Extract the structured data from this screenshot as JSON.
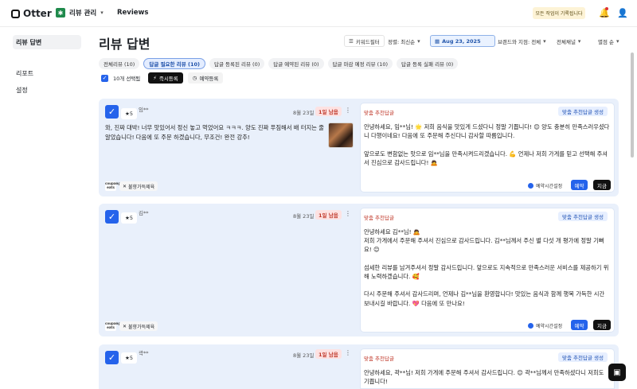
{
  "app": {
    "name": "Otter",
    "store_label": "리뷰 관리",
    "nav_reviews": "Reviews",
    "banner": "모든 작업이 기록됩니다",
    "store_icon": "store-icon"
  },
  "sidebar": {
    "items": [
      {
        "label": "리뷰 답변"
      },
      {
        "label": "리포트"
      },
      {
        "label": "설정"
      }
    ]
  },
  "page": {
    "title": "리뷰 답변"
  },
  "filters": {
    "keyword": "키워드필터",
    "sort": "정렬: 최신순",
    "date": "Aug 23, 2025",
    "brand": "브랜드와 지점: 전체",
    "channel": "전체채널",
    "rating": "별점 순"
  },
  "tabs": [
    {
      "label": "전체리뷰 (10)"
    },
    {
      "label": "답글 필요한 리뷰 (10)"
    },
    {
      "label": "답글 등록된 리뷰 (0)"
    },
    {
      "label": "답글 예약된 리뷰 (0)"
    },
    {
      "label": "답글 마감 예정 리뷰 (10)"
    },
    {
      "label": "답글 등록 실패 리뷰 (0)"
    }
  ],
  "actions": {
    "selected": "10개 선택됨",
    "instant": "즉시등록",
    "schedule": "예약등록"
  },
  "cards": [
    {
      "rating": "★5",
      "name": "임**",
      "date": "8월 23일",
      "badge": "1일 남음",
      "more": "⋮",
      "review": "와, 진짜 대박! 너무 맛있어서 정신 놓고 먹었어요 ㅋㅋㅋ. 양도 진짜 푸짐해서 배 터지는 줄 알았습니다! 다음에 또 주문 하겠습니다, 무조건! 완전 강추!",
      "platform": "coupang eats",
      "menu": "불향가득제육",
      "ai_label": "맞춤 추천답글",
      "gen_label": "맞춤 추천답글 생성",
      "reply": "안녕하세요, 임**님! 🌟 저희 음식을 맛있게 드셨다니 정말 기쁩니다! 😊 양도 충분히 만족스러우셨다니 다행이네요! 다음에 또 주문해 주신다니 감사할 따름입니다.\n\n앞으로도 변함없는 맛으로 임**님을 만족시켜드리겠습니다. 💪 언제나 저희 가게를 믿고 선택해 주셔서 진심으로 감사드립니다! 🙇",
      "schedule": "예약시간설정",
      "reserve": "예약",
      "now": "지금"
    },
    {
      "rating": "★5",
      "name": "김**",
      "date": "8월 23일",
      "badge": "1일 남음",
      "more": "⋮",
      "review": "",
      "platform": "coupang eats",
      "menu": "불향가득제육",
      "ai_label": "맞춤 추천답글",
      "gen_label": "맞춤 추천답글 생성",
      "reply": "안녕하세요 김**님! 🙇\n저희 가게에서 주문해 주셔서 진심으로 감사드립니다. 김**님께서 주신 별 다섯 개 평가에 정말 기뻐요! 😊\n\n섬세한 리뷰를 남겨주셔서 정말 감사드립니다. 앞으로도 지속적으로 만족스러운 서비스를 제공하기 위해 노력하겠습니다. 🥰\n\n다시 주문해 주셔서 감사드리며, 언제나 김**님을 환영합니다! 맛있는 음식과 함께 행복 가득한 시간 보내시길 바랍니다. 💖 다음에 또 만나요!",
      "schedule": "예약시간설정",
      "reserve": "예약",
      "now": "지금"
    },
    {
      "rating": "★5",
      "name": "곽**",
      "date": "8월 23일",
      "badge": "1일 남음",
      "more": "⋮",
      "review": "",
      "ai_label": "맞춤 추천답글",
      "gen_label": "맞춤 추천답글 생성",
      "reply": "안녕하세요, 곽**님! 저희 가게에 주문해 주셔서 감사드립니다. 😊 곽**님께서 만족하셨다니 저희도 기쁩니다!"
    }
  ],
  "colors": {
    "accent": "#2563eb",
    "card_bg": "#e9f0fb",
    "badge": "#fde2e2",
    "banner": "#fdf3d6"
  }
}
